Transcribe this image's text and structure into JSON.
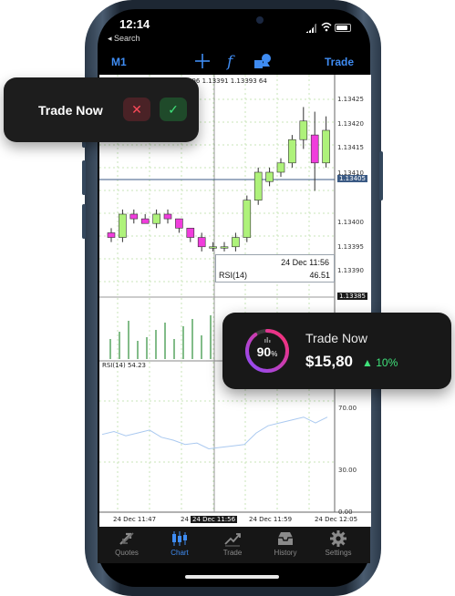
{
  "status_bar": {
    "time": "12:14",
    "back_label": "◂ Search"
  },
  "toolbar": {
    "timeframe": "M1",
    "trade_label": "Trade",
    "icons": [
      "crosshair-icon",
      "function-icon",
      "objects-icon"
    ]
  },
  "chart": {
    "top_prices": "996  1.13391  1.13393  64",
    "price_labels": [
      "1.13425",
      "1.13420",
      "1.13415",
      "1.13410",
      "1.13405",
      "1.13400",
      "1.13395",
      "1.13390",
      "1.13385"
    ],
    "info_box": {
      "date": "24 Dec 11:56",
      "label": "RSI(14)",
      "value": "46.51"
    },
    "rsi_title": "RSI(14) 54.23",
    "rsi_levels": [
      "70.00",
      "30.00",
      "0.00"
    ],
    "time_labels": [
      "24 Dec 11:47",
      "24 Dec 11:56",
      "24 Dec 11:59",
      "24 Dec 12:05"
    ],
    "partial_time_label": "24",
    "colors": {
      "bull": "#aef27a",
      "bear": "#f03ddc",
      "grid": "#c8e6b9",
      "rsi_line": "#aac9f0"
    }
  },
  "chart_data": {
    "type": "candlestick",
    "series": [
      {
        "name": "price",
        "ohlc": [
          [
            1.13397,
            1.13398,
            1.13395,
            1.13396
          ],
          [
            1.13396,
            1.13402,
            1.13395,
            1.13401
          ],
          [
            1.13401,
            1.13402,
            1.13399,
            1.134
          ],
          [
            1.134,
            1.13401,
            1.13399,
            1.13399
          ],
          [
            1.13399,
            1.13402,
            1.13398,
            1.13401
          ],
          [
            1.13401,
            1.13402,
            1.13399,
            1.134
          ],
          [
            1.134,
            1.134,
            1.13397,
            1.13398
          ],
          [
            1.13398,
            1.13398,
            1.13395,
            1.13396
          ],
          [
            1.13396,
            1.13397,
            1.13393,
            1.13394
          ],
          [
            1.13394,
            1.13395,
            1.13393,
            1.13394
          ],
          [
            1.13394,
            1.13395,
            1.13393,
            1.13394
          ],
          [
            1.13394,
            1.13397,
            1.13393,
            1.13396
          ],
          [
            1.13396,
            1.13405,
            1.13395,
            1.13404
          ],
          [
            1.13404,
            1.13411,
            1.13403,
            1.1341
          ],
          [
            1.13408,
            1.13411,
            1.13407,
            1.1341
          ],
          [
            1.1341,
            1.13413,
            1.13409,
            1.13412
          ],
          [
            1.13412,
            1.13418,
            1.13411,
            1.13417
          ],
          [
            1.13417,
            1.13424,
            1.13415,
            1.13421
          ],
          [
            1.13418,
            1.13423,
            1.13406,
            1.13412
          ],
          [
            1.13412,
            1.13422,
            1.13411,
            1.13419
          ]
        ]
      },
      {
        "name": "volume",
        "values": [
          22,
          30,
          42,
          20,
          24,
          32,
          40,
          22,
          36,
          44,
          26,
          48
        ]
      },
      {
        "name": "RSI(14)",
        "values": [
          54,
          56,
          53,
          55,
          57,
          52,
          50,
          47,
          48,
          44,
          45,
          46,
          47,
          55,
          60,
          62,
          64,
          66,
          62,
          66
        ]
      }
    ],
    "rsi_levels": [
      70,
      30,
      0
    ]
  },
  "tab_bar": {
    "items": [
      {
        "label": "Quotes",
        "icon": "quotes-icon",
        "active": false
      },
      {
        "label": "Chart",
        "icon": "chart-icon",
        "active": true
      },
      {
        "label": "Trade",
        "icon": "trade-icon",
        "active": false
      },
      {
        "label": "History",
        "icon": "history-icon",
        "active": false
      },
      {
        "label": "Settings",
        "icon": "settings-icon",
        "active": false
      }
    ]
  },
  "card_left": {
    "title": "Trade Now",
    "reject_icon": "✕",
    "accept_icon": "✓"
  },
  "card_right": {
    "percent": "90",
    "percent_unit": "%",
    "title": "Trade Now",
    "amount": "$15,80",
    "change": "10%",
    "change_arrow": "▲",
    "progress": 0.9
  }
}
